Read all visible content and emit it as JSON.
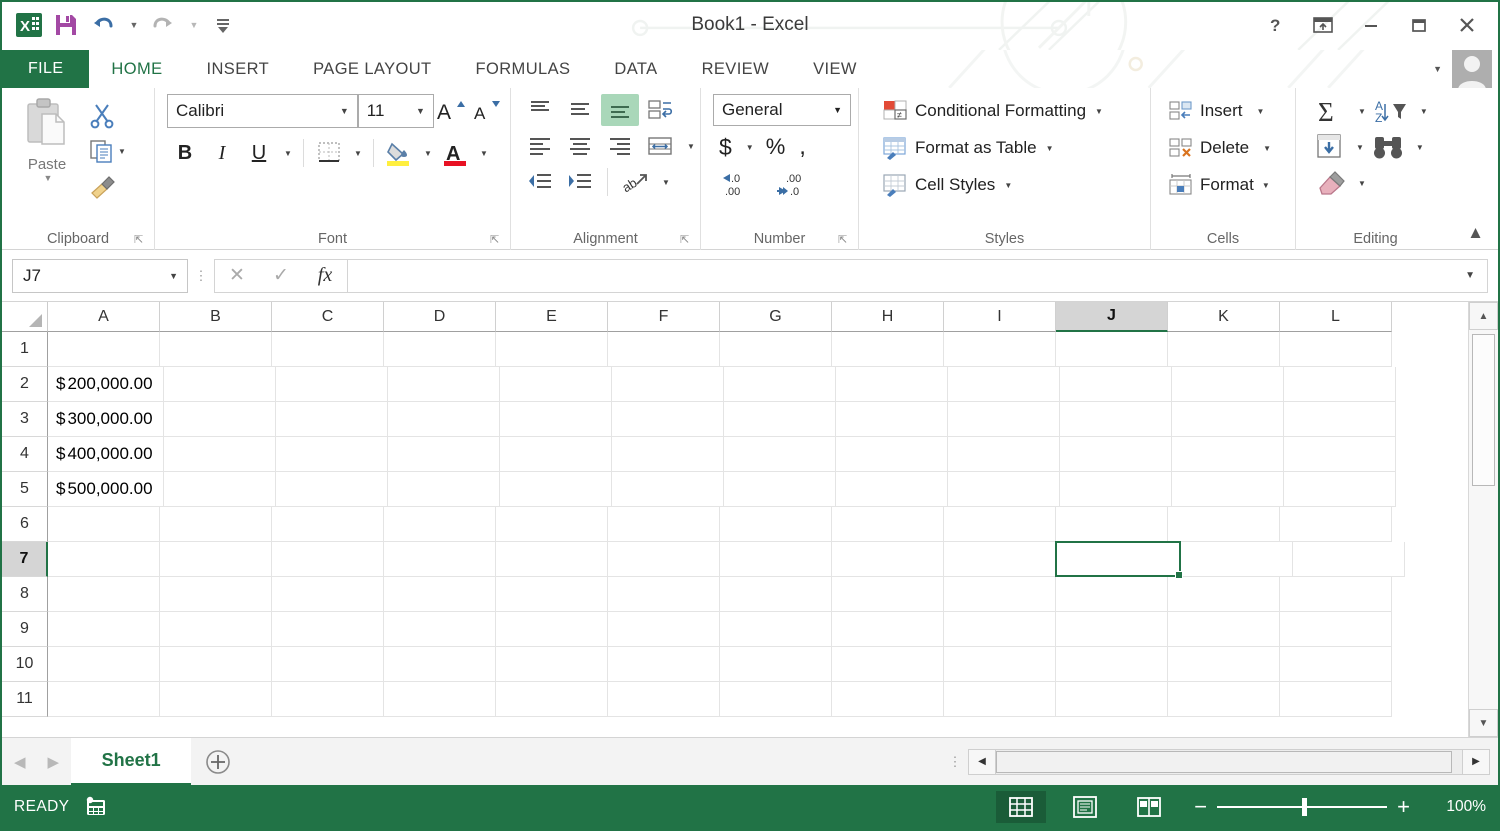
{
  "window": {
    "title": "Book1 - Excel",
    "accent_green": "#217346",
    "controls": [
      {
        "name": "help",
        "glyph": "?"
      },
      {
        "name": "ribbon-display-options",
        "glyph": "❐"
      },
      {
        "name": "minimize",
        "glyph": "—"
      },
      {
        "name": "maximize",
        "glyph": "☐"
      },
      {
        "name": "close",
        "glyph": "✕"
      }
    ]
  },
  "quick_access": [
    {
      "name": "excel-logo-icon",
      "label": "X"
    },
    {
      "name": "save-icon",
      "label": "Save"
    },
    {
      "name": "undo-icon",
      "label": "Undo"
    },
    {
      "name": "redo-icon",
      "label": "Redo"
    },
    {
      "name": "customize-qat-icon",
      "label": "Customize Quick Access Toolbar"
    }
  ],
  "tabs": [
    {
      "label": "FILE",
      "active": false
    },
    {
      "label": "HOME",
      "active": true
    },
    {
      "label": "INSERT",
      "active": false
    },
    {
      "label": "PAGE LAYOUT",
      "active": false
    },
    {
      "label": "FORMULAS",
      "active": false
    },
    {
      "label": "DATA",
      "active": false
    },
    {
      "label": "REVIEW",
      "active": false
    },
    {
      "label": "VIEW",
      "active": false
    }
  ],
  "ribbon": {
    "clipboard": {
      "group_label": "Clipboard",
      "paste_label": "Paste",
      "cut_label": "Cut",
      "copy_label": "Copy",
      "format_painter_label": "Format Painter",
      "launcher_label": "Clipboard dialog launcher"
    },
    "font": {
      "group_label": "Font",
      "font_name": "Calibri",
      "font_size": "11",
      "bold_label": "B",
      "italic_label": "I",
      "underline_label": "U",
      "grow_font_label": "A",
      "shrink_font_label": "A",
      "borders_label": "Borders",
      "fill_color_label": "Fill Color",
      "font_color_label": "A",
      "launcher_label": "Font dialog launcher"
    },
    "alignment": {
      "group_label": "Alignment",
      "top_align_label": "Top Align",
      "middle_align_label": "Middle Align",
      "bottom_align_label": "Bottom Align",
      "wrap_text_label": "Wrap Text",
      "align_left_label": "Align Left",
      "center_label": "Center",
      "align_right_label": "Align Right",
      "merge_center_label": "Merge & Center",
      "decrease_indent_label": "Decrease Indent",
      "increase_indent_label": "Increase Indent",
      "orientation_label": "Orientation",
      "selected_button": "Bottom Align",
      "launcher_label": "Alignment dialog launcher"
    },
    "number": {
      "group_label": "Number",
      "format": "General",
      "accounting_label": "$",
      "percent_label": "%",
      "comma_label": ",",
      "increase_decimal_label": "Increase Decimal",
      "decrease_decimal_label": "Decrease Decimal",
      "launcher_label": "Number dialog launcher"
    },
    "styles": {
      "group_label": "Styles",
      "items": [
        {
          "label": "Conditional Formatting"
        },
        {
          "label": "Format as Table"
        },
        {
          "label": "Cell Styles"
        }
      ]
    },
    "cells": {
      "group_label": "Cells",
      "items": [
        {
          "label": "Insert"
        },
        {
          "label": "Delete"
        },
        {
          "label": "Format"
        }
      ]
    },
    "editing": {
      "group_label": "Editing",
      "autosum_label": "AutoSum",
      "sort_filter_label": "Sort & Filter",
      "fill_label": "Fill",
      "find_select_label": "Find & Select",
      "clear_label": "Clear"
    },
    "collapse_label": "Collapse the Ribbon"
  },
  "formula_bar": {
    "name_box": "J7",
    "formula_value": "",
    "formula_placeholder": "",
    "cancel_label": "Cancel",
    "enter_label": "Enter",
    "fx_label": "fx",
    "expand_label": "Expand Formula Bar"
  },
  "grid": {
    "columns": [
      "A",
      "B",
      "C",
      "D",
      "E",
      "F",
      "G",
      "H",
      "I",
      "J",
      "K",
      "L"
    ],
    "selected_column": "J",
    "rows": [
      "1",
      "2",
      "3",
      "4",
      "5",
      "6",
      "7",
      "8",
      "9",
      "10",
      "11"
    ],
    "selected_row": "7",
    "selected_cell": "J7",
    "cells": {
      "A2": "$ 200,000.00",
      "A3": "$ 300,000.00",
      "A4": "$ 400,000.00",
      "A5": "$ 500,000.00"
    },
    "cell_values": [
      {
        "ref": "A2",
        "currency": "$",
        "amount": "200,000.00"
      },
      {
        "ref": "A3",
        "currency": "$",
        "amount": "300,000.00"
      },
      {
        "ref": "A4",
        "currency": "$",
        "amount": "400,000.00"
      },
      {
        "ref": "A5",
        "currency": "$",
        "amount": "500,000.00"
      }
    ]
  },
  "sheet_bar": {
    "prev_label": "Previous sheet",
    "next_label": "Next sheet",
    "sheets": [
      {
        "label": "Sheet1",
        "active": true
      }
    ],
    "add_sheet_label": "New sheet"
  },
  "status_bar": {
    "status": "READY",
    "macro_label": "Record Macro",
    "views": [
      {
        "name": "normal-view",
        "label": "Normal",
        "active": true
      },
      {
        "name": "page-layout-view",
        "label": "Page Layout",
        "active": false
      },
      {
        "name": "page-break-view",
        "label": "Page Break Preview",
        "active": false
      }
    ],
    "zoom_out_label": "−",
    "zoom_in_label": "+",
    "zoom_value": "100%"
  }
}
